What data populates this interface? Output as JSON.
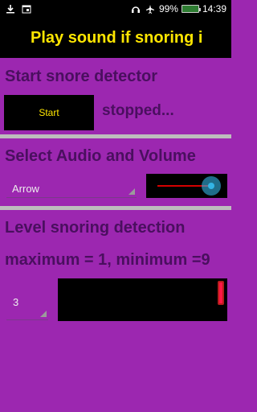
{
  "status_bar": {
    "battery_percent": "99%",
    "time": "14:39",
    "icons": [
      "download-icon",
      "calendar-icon",
      "headphones-icon",
      "airplane-icon",
      "battery-icon"
    ]
  },
  "title": "Play sound if snoring i",
  "sections": {
    "start": {
      "heading": "Start snore detector",
      "button_label": "Start",
      "status": "stopped..."
    },
    "audio": {
      "heading": "Select Audio and Volume",
      "selected_audio": "Arrow",
      "volume_level": 0.9
    },
    "level": {
      "heading": "Level snoring detection",
      "range_text": "maximum = 1, minimum =9",
      "selected_level": "3",
      "meter_level": 1.0
    }
  },
  "colors": {
    "background": "#9c27b0",
    "heading_text": "#4a0f5f",
    "title_text": "#ffe600",
    "slider_track": "#d50000",
    "slider_thumb": "#33b5e5",
    "meter_bar": "#ff1744"
  }
}
